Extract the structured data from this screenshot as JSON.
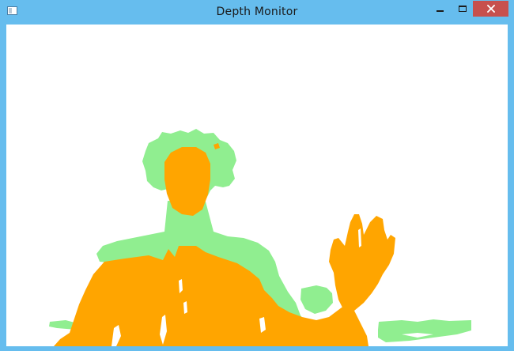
{
  "window": {
    "title": "Depth Monitor",
    "icon": "app-window-icon"
  },
  "controls": {
    "minimize": "minimize-icon",
    "maximize": "maximize-icon",
    "close": "close-icon"
  },
  "depth_view": {
    "colors": {
      "near": "#FFA500",
      "far": "#90EE90",
      "background": "#FFFFFF",
      "titlebar": "#66BDEE",
      "close_button": "#C7504D"
    }
  }
}
